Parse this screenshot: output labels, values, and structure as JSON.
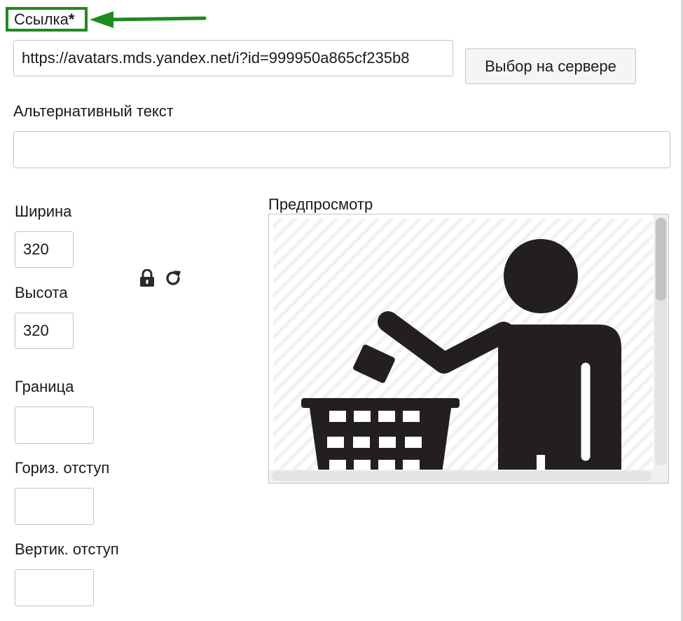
{
  "url_section": {
    "label": "Ссылка",
    "required_mark": "*",
    "value": "https://avatars.mds.yandex.net/i?id=999950a865cf235b8",
    "browse_button": "Выбор на сервере"
  },
  "alt_section": {
    "label": "Альтернативный текст",
    "value": ""
  },
  "dimensions": {
    "width_label": "Ширина",
    "width_value": "320",
    "height_label": "Высота",
    "height_value": "320",
    "lock_icon": "lock-icon",
    "reset_icon": "refresh-icon"
  },
  "border": {
    "label": "Граница",
    "value": ""
  },
  "hspace": {
    "label": "Гориз. отступ",
    "value": ""
  },
  "vspace": {
    "label": "Вертик. отступ",
    "value": ""
  },
  "preview": {
    "label": "Предпросмотр",
    "image_icon": "person-throwing-trash-in-bin-icon"
  },
  "colors": {
    "highlight": "#1f8a1f",
    "border": "#c4c4c4",
    "icon_dark": "#231f20"
  }
}
